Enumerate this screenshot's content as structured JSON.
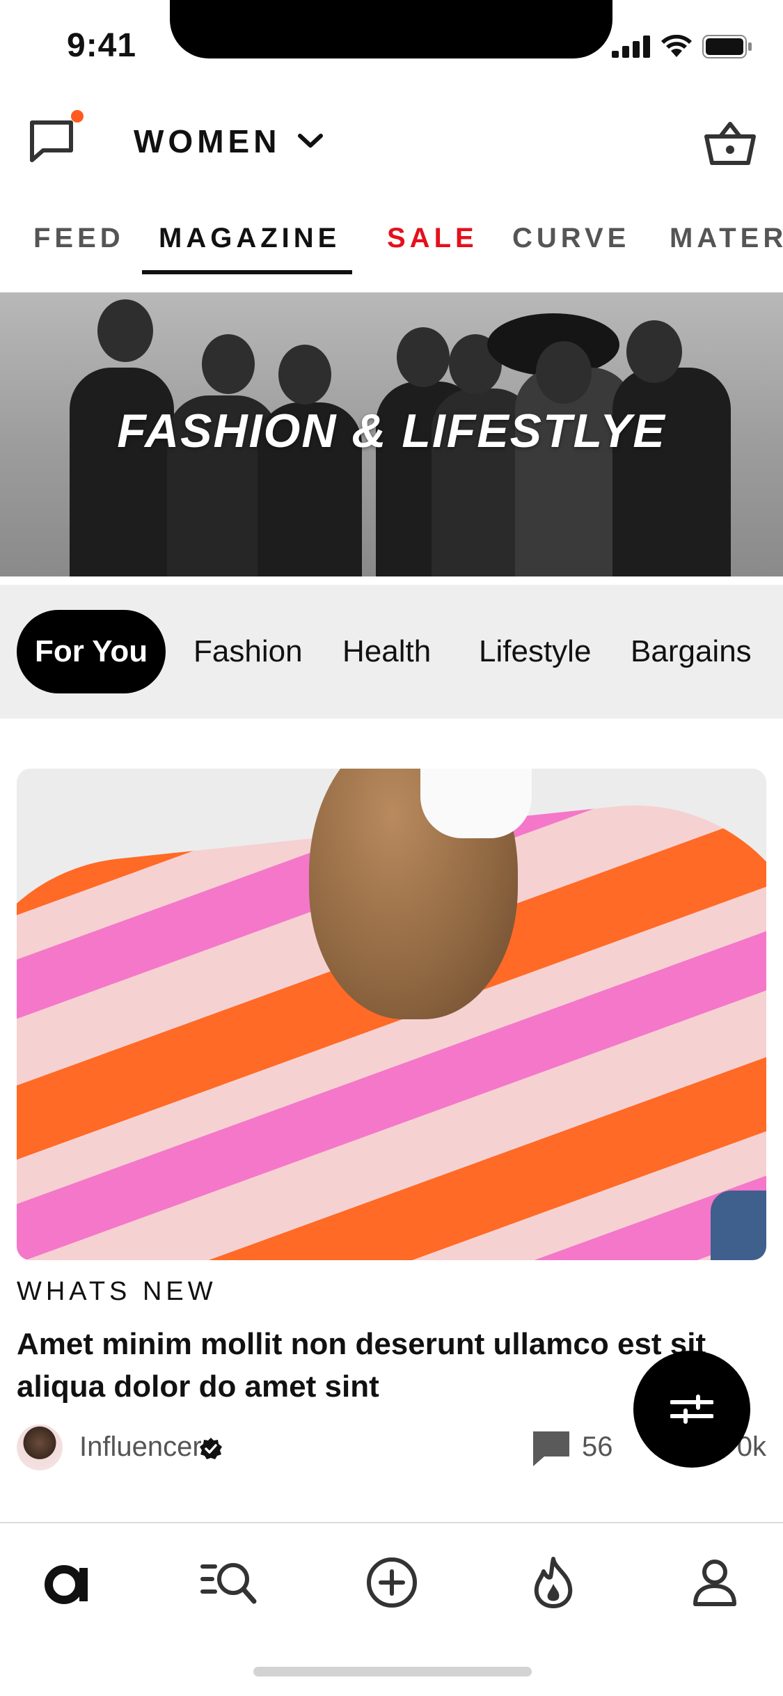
{
  "status_bar": {
    "time": "9:41"
  },
  "header": {
    "gender_label": "WOMEN",
    "has_unread_messages": true
  },
  "main_tabs": [
    {
      "label": "FEED",
      "color": "#555555"
    },
    {
      "label": "MAGAZINE",
      "color": "#111111",
      "active": true
    },
    {
      "label": "SALE",
      "color": "#e4101c"
    },
    {
      "label": "CURVE",
      "color": "#555555"
    },
    {
      "label": "MATERI",
      "color": "#555555"
    }
  ],
  "banner": {
    "title": "FASHION & LIFESTLYE"
  },
  "categories": [
    {
      "label": "For You",
      "active": true
    },
    {
      "label": "Fashion"
    },
    {
      "label": "Health"
    },
    {
      "label": "Lifestyle"
    },
    {
      "label": "Bargains"
    }
  ],
  "article": {
    "kicker": "WHATS NEW",
    "headline": "Amet minim mollit non deserunt ullamco est sit aliqua dolor do amet sint",
    "author": "Influencer",
    "comments": "56",
    "likes": "0k"
  },
  "bottom_nav": [
    {
      "name": "home",
      "icon": "asos-logo-icon"
    },
    {
      "name": "search",
      "icon": "search-list-icon"
    },
    {
      "name": "create",
      "icon": "plus-circle-icon"
    },
    {
      "name": "trending",
      "icon": "flame-icon"
    },
    {
      "name": "profile",
      "icon": "user-icon"
    }
  ],
  "colors": {
    "accent_notification": "#ff5a1f",
    "sale": "#e4101c",
    "chip_bg": "#eeeeee",
    "black": "#000000"
  }
}
